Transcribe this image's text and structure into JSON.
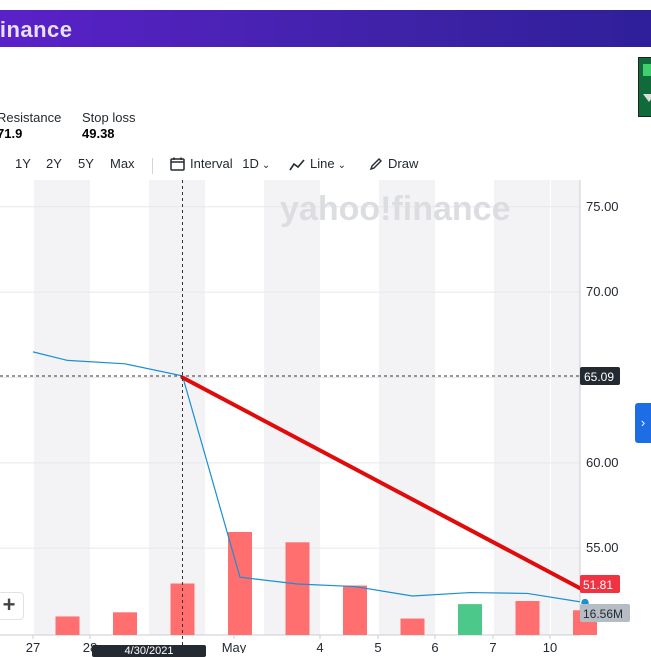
{
  "header": {
    "brand": "finance"
  },
  "stats": {
    "resistance_label": "Resistance",
    "resistance_value": "71.9",
    "stoploss_label": "Stop loss",
    "stoploss_value": "49.38"
  },
  "toolbar": {
    "ranges": [
      "1Y",
      "2Y",
      "5Y",
      "Max"
    ],
    "interval_label": "Interval",
    "interval_value": "1D",
    "chart_type": "Line",
    "draw_label": "Draw"
  },
  "watermark": "yahoo!finance",
  "chart_data": {
    "type": "line",
    "x_labels": [
      "27",
      "28",
      "4/30/2021",
      "May",
      "4",
      "5",
      "6",
      "7",
      "10"
    ],
    "y_ticks": [
      "75.00",
      "70.00",
      "65.00",
      "60.00",
      "55.00"
    ],
    "ylim": [
      50.8,
      76.1
    ],
    "price_series": [
      {
        "t": 0,
        "y": 66.5
      },
      {
        "t": 0.6,
        "y": 66.0
      },
      {
        "t": 1.6,
        "y": 65.8
      },
      {
        "t": 2.6,
        "y": 65.09
      },
      {
        "t": 3.6,
        "y": 53.3
      },
      {
        "t": 4.6,
        "y": 52.9
      },
      {
        "t": 5.6,
        "y": 52.75
      },
      {
        "t": 6.6,
        "y": 52.2
      },
      {
        "t": 7.6,
        "y": 52.4
      },
      {
        "t": 8.6,
        "y": 52.35
      },
      {
        "t": 9.6,
        "y": 51.81
      }
    ],
    "trendline": {
      "from": {
        "t": 2.6,
        "y": 65.0
      },
      "to": {
        "t": 9.6,
        "y": 52.5
      }
    },
    "crosshair_value": "65.09",
    "last_price": "51.81",
    "volume_label": "16.56M",
    "volume_bars": [
      {
        "t": 0.6,
        "v": 0.18,
        "dir": "down"
      },
      {
        "t": 1.6,
        "v": 0.22,
        "dir": "down"
      },
      {
        "t": 2.6,
        "v": 0.5,
        "dir": "down"
      },
      {
        "t": 3.6,
        "v": 1.0,
        "dir": "down"
      },
      {
        "t": 4.6,
        "v": 0.9,
        "dir": "down"
      },
      {
        "t": 5.6,
        "v": 0.48,
        "dir": "down"
      },
      {
        "t": 6.6,
        "v": 0.16,
        "dir": "down"
      },
      {
        "t": 7.6,
        "v": 0.3,
        "dir": "up"
      },
      {
        "t": 8.6,
        "v": 0.33,
        "dir": "down"
      },
      {
        "t": 9.6,
        "v": 0.24,
        "dir": "down"
      }
    ],
    "colors": {
      "line": "#1a8fd1",
      "trend": "#e00b0b",
      "down": "#ff6f6f",
      "up": "#4cc98a",
      "last": "#ef3340",
      "crosshair_tag": "#232a31",
      "volume_tag": "#b6bcc4"
    }
  }
}
